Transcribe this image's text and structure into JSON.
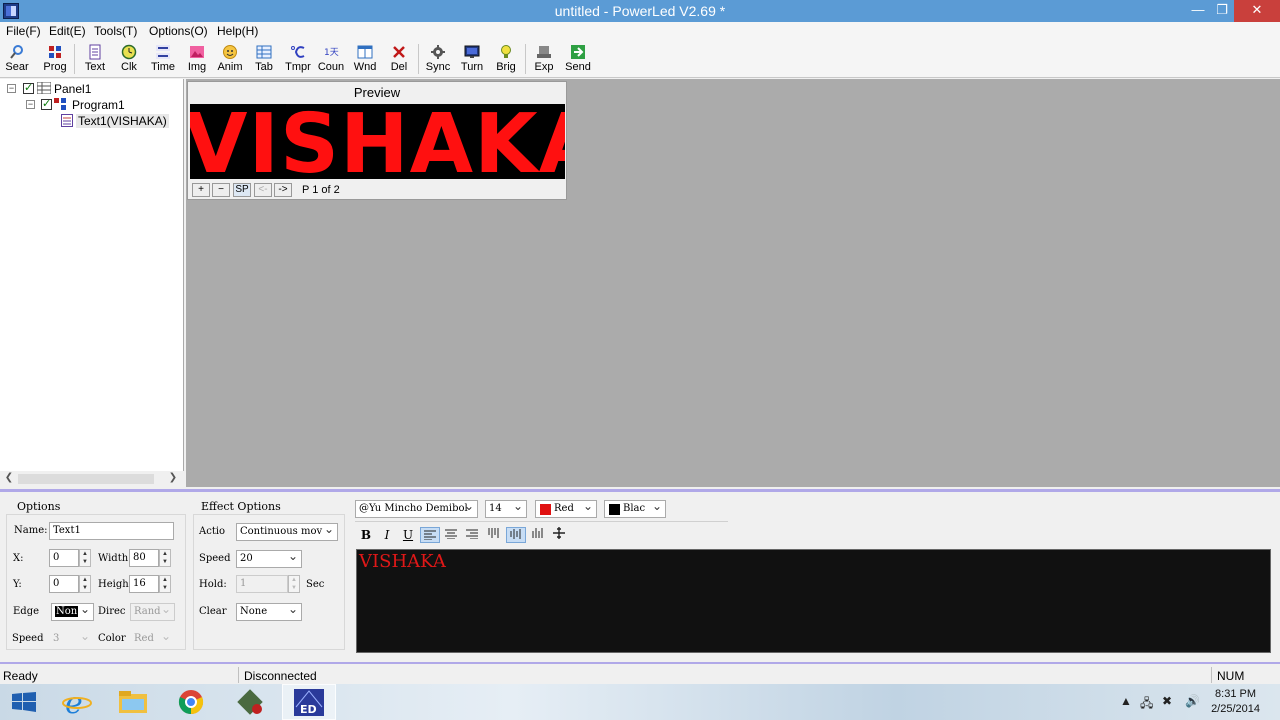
{
  "window": {
    "title": "untitled - PowerLed V2.69 *",
    "minimize": "—",
    "maximize": "❐",
    "close": "✕"
  },
  "menu": [
    "File(F)",
    "Edit(E)",
    "Tools(T)",
    "Options(O)",
    "Help(H)"
  ],
  "toolbar": {
    "sear": "Sear",
    "prog": "Prog",
    "text": "Text",
    "clk": "Clk",
    "time": "Time",
    "img": "Img",
    "anim": "Anim",
    "tab": "Tab",
    "tmpr": "Tmpr",
    "coun": "Coun",
    "wnd": "Wnd",
    "del": "Del",
    "sync": "Sync",
    "turn": "Turn",
    "brig": "Brig",
    "exp": "Exp",
    "send": "Send"
  },
  "tree": {
    "panel": "Panel1",
    "program": "Program1",
    "text": "Text1(VISHAKA)"
  },
  "preview": {
    "title": "Preview",
    "display_text": "VISHAKA",
    "plus": "+",
    "minus": "−",
    "sp": "SP",
    "prev": "<-",
    "next": "->",
    "page": "P 1 of 2"
  },
  "options": {
    "title": "Options",
    "name_label": "Name:",
    "name_value": "Text1",
    "x_label": "X:",
    "x_value": "0",
    "width_label": "Width",
    "width_value": "80",
    "y_label": "Y:",
    "y_value": "0",
    "height_label": "Heigh",
    "height_value": "16",
    "edge_label": "Edge",
    "edge_value": "Non",
    "direc_label": "Direc",
    "direc_value": "Rand",
    "speed_label": "Speed",
    "speed_value": "3",
    "color_label": "Color",
    "color_value": "Red"
  },
  "effect": {
    "title": "Effect Options",
    "action_label": "Actio",
    "action_value": "Continuous mov",
    "speed_label": "Speed",
    "speed_value": "20",
    "hold_label": "Hold:",
    "hold_value": "1",
    "hold_unit": "Sec",
    "clear_label": "Clear",
    "clear_value": "None"
  },
  "format": {
    "font": "@Yu Mincho Demibol",
    "size": "14",
    "fg_color_name": "Red",
    "fg_color": "#e01010",
    "bg_color_name": "Blac",
    "bg_color": "#000000",
    "bold": "B",
    "italic": "I",
    "underline": "U"
  },
  "editor": {
    "text": "VISHAKA"
  },
  "status": {
    "ready": "Ready",
    "connection": "Disconnected",
    "num": "NUM"
  },
  "clock": {
    "time": "8:31 PM",
    "date": "2/25/2014"
  }
}
